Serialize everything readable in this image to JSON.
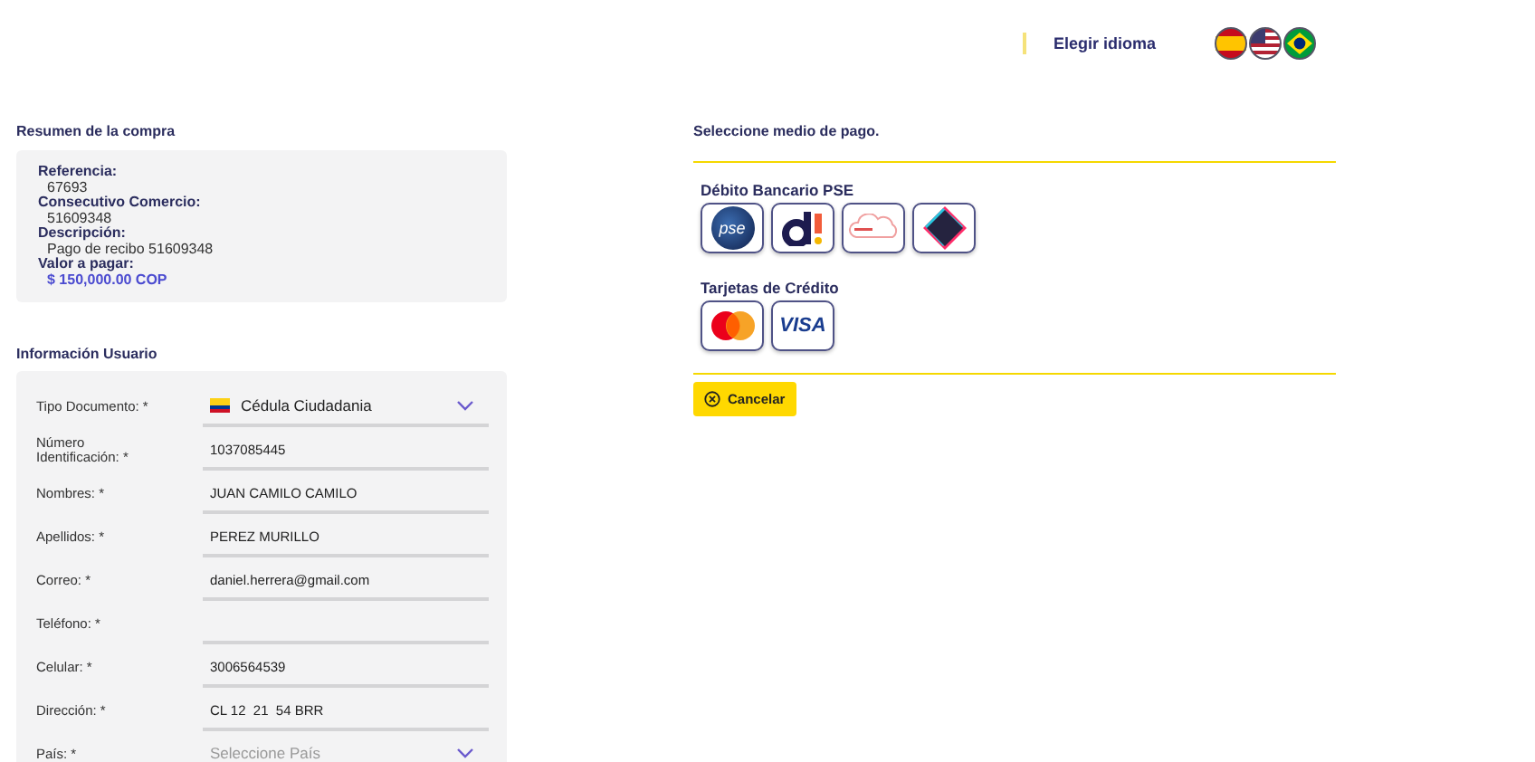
{
  "header": {
    "language_label": "Elegir idioma",
    "languages": [
      {
        "kind": "es",
        "selected": false
      },
      {
        "kind": "us",
        "selected": false
      },
      {
        "kind": "br",
        "selected": false
      }
    ]
  },
  "summary": {
    "title": "Resumen de la compra",
    "items": [
      {
        "label": "Referencia:",
        "value": "67693",
        "kind": "plain"
      },
      {
        "label": "Consecutivo Comercio:",
        "value": "51609348",
        "kind": "plain"
      },
      {
        "label": "Descripción:",
        "value": "Pago de recibo 51609348",
        "kind": "plain"
      },
      {
        "label": "Valor a pagar:",
        "value": "$ 150,000.00 COP",
        "kind": "amount"
      }
    ]
  },
  "user_info": {
    "title": "Información Usuario",
    "fields": [
      {
        "label": "Tipo Documento: *",
        "kind": "flag_select",
        "value": "Cédula Ciudadania"
      },
      {
        "label": "Número Identificación: *",
        "kind": "text",
        "value": "1037085445"
      },
      {
        "label": "Nombres: *",
        "kind": "text",
        "value": "JUAN CAMILO CAMILO"
      },
      {
        "label": "Apellidos: *",
        "kind": "text",
        "value": "PEREZ MURILLO"
      },
      {
        "label": "Correo: *",
        "kind": "text",
        "value": "daniel.herrera@gmail.com"
      },
      {
        "label": "Teléfono: *",
        "kind": "text"
      },
      {
        "label": "Celular: *",
        "kind": "text",
        "value": "3006564539"
      },
      {
        "label": "Dirección: *",
        "kind": "text",
        "value": "CL 12  21  54 BRR"
      },
      {
        "label": "País: *",
        "kind": "select",
        "placeholder": "Seleccione País"
      }
    ]
  },
  "payment": {
    "title": "Seleccione medio de pago.",
    "groups": [
      {
        "title": "Débito Bancario PSE",
        "methods": [
          {
            "kind": "pse",
            "label": "pse"
          },
          {
            "kind": "dlogo"
          },
          {
            "kind": "daleplata"
          },
          {
            "kind": "diamond"
          }
        ]
      },
      {
        "title": "Tarjetas de Crédito",
        "methods": [
          {
            "kind": "mastercard"
          },
          {
            "kind": "visa",
            "label": "VISA"
          }
        ]
      }
    ],
    "cancel": "Cancelar"
  }
}
